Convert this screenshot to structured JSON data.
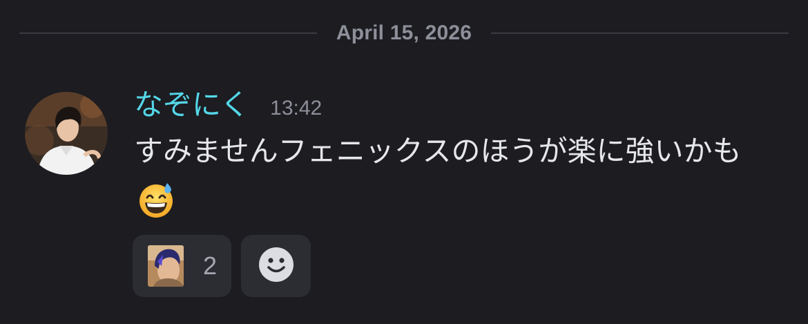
{
  "divider": {
    "date": "April 15, 2026"
  },
  "message": {
    "username": "なぞにく",
    "username_color": "#54d7e8",
    "timestamp": "13:42",
    "text": "すみませんフェニックスのほうが楽に強いかも",
    "emoji": "grinning-face-with-sweat"
  },
  "reactions": [
    {
      "icon": "custom-avatar-emoji",
      "count": "2"
    }
  ],
  "add_reaction": {
    "icon": "smiley-face-icon"
  }
}
